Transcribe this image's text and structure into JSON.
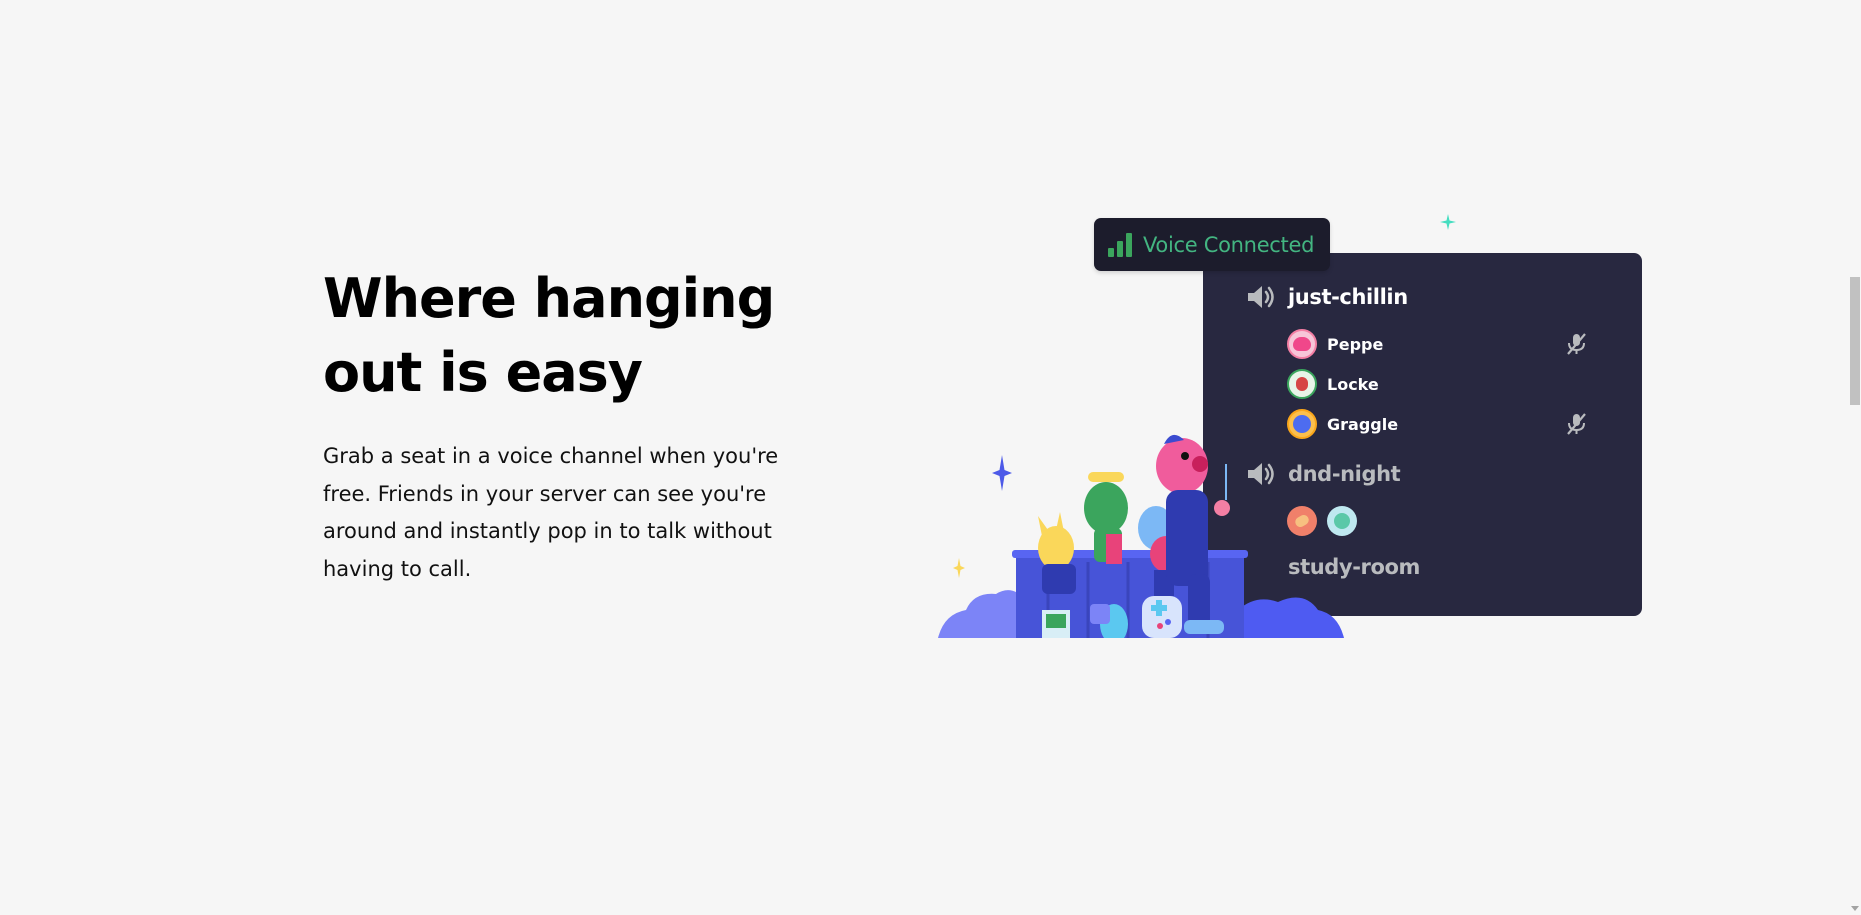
{
  "section": {
    "title": "Where hanging out is easy",
    "description": "Grab a seat in a voice channel when you're free. Friends in your server can see you're around and instantly pop in to talk without having to call."
  },
  "voice_status": {
    "label": "Voice Connected",
    "color": "#43b581"
  },
  "channels": [
    {
      "name": "just-chillin",
      "icon": "speaker-icon",
      "users": [
        {
          "name": "Peppe",
          "muted": true,
          "avatar_color": "#f47fa4"
        },
        {
          "name": "Locke",
          "muted": false,
          "avatar_color": "#3ba55d"
        },
        {
          "name": "Graggle",
          "muted": true,
          "avatar_color": "#faa61a"
        }
      ]
    },
    {
      "name": "dnd-night",
      "icon": "speaker-icon",
      "avatars": [
        {
          "avatar_color": "#f0806a"
        },
        {
          "avatar_color": "#bfe8f0"
        }
      ]
    },
    {
      "name": "study-room"
    }
  ],
  "colors": {
    "page_bg": "#f6f6f6",
    "panel_bg": "#282840",
    "blurple": "#5865f2"
  }
}
